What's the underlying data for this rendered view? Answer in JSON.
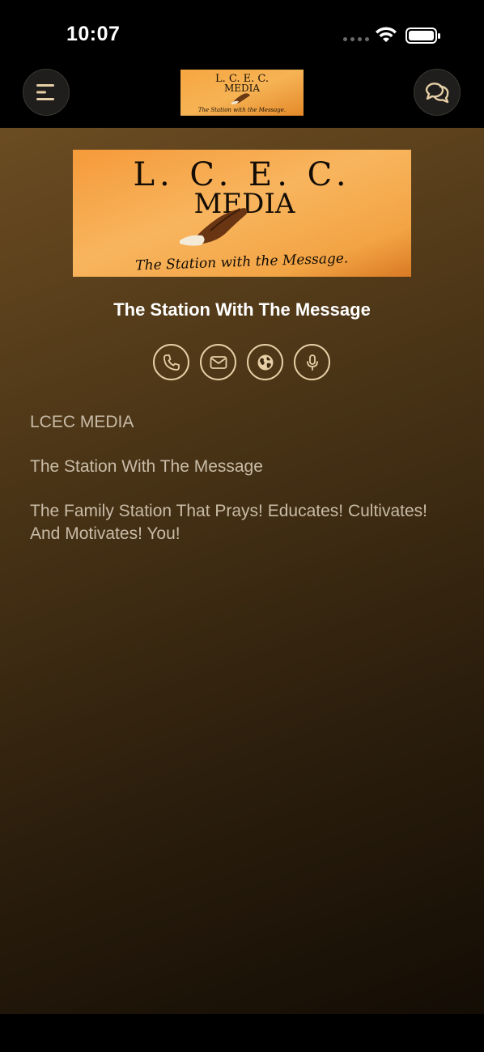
{
  "status_bar": {
    "time": "10:07"
  },
  "nav": {
    "menu_icon": "menu-icon",
    "chat_icon": "chat-bubbles-icon",
    "logo": {
      "line1": "L. C. E. C.",
      "line2": "MEDIA",
      "line3": "The Station with the Message."
    }
  },
  "hero": {
    "logo": {
      "line1": "L. C. E. C.",
      "line2": "MEDIA",
      "line3": "The Station with the Message."
    },
    "title": "The Station With The Message"
  },
  "actions": [
    {
      "icon": "phone-icon"
    },
    {
      "icon": "mail-icon"
    },
    {
      "icon": "globe-icon"
    },
    {
      "icon": "microphone-icon"
    }
  ],
  "description": {
    "line1": "LCEC MEDIA",
    "line2": "The Station With The Message",
    "line3": "The Family Station That Prays! Educates! Cultivates! And Motivates! You!"
  },
  "colors": {
    "accent": "#e6cfa6",
    "logo_bg": "#f3a43a",
    "background_top": "#6b4c22",
    "background_bottom": "#140d05"
  }
}
